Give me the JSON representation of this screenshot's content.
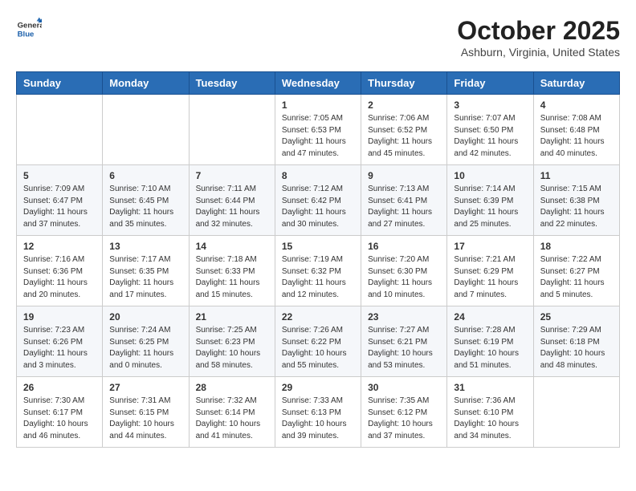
{
  "header": {
    "logo_general": "General",
    "logo_blue": "Blue",
    "month": "October 2025",
    "location": "Ashburn, Virginia, United States"
  },
  "days_of_week": [
    "Sunday",
    "Monday",
    "Tuesday",
    "Wednesday",
    "Thursday",
    "Friday",
    "Saturday"
  ],
  "weeks": [
    [
      {
        "day": "",
        "content": ""
      },
      {
        "day": "",
        "content": ""
      },
      {
        "day": "",
        "content": ""
      },
      {
        "day": "1",
        "content": "Sunrise: 7:05 AM\nSunset: 6:53 PM\nDaylight: 11 hours and 47 minutes."
      },
      {
        "day": "2",
        "content": "Sunrise: 7:06 AM\nSunset: 6:52 PM\nDaylight: 11 hours and 45 minutes."
      },
      {
        "day": "3",
        "content": "Sunrise: 7:07 AM\nSunset: 6:50 PM\nDaylight: 11 hours and 42 minutes."
      },
      {
        "day": "4",
        "content": "Sunrise: 7:08 AM\nSunset: 6:48 PM\nDaylight: 11 hours and 40 minutes."
      }
    ],
    [
      {
        "day": "5",
        "content": "Sunrise: 7:09 AM\nSunset: 6:47 PM\nDaylight: 11 hours and 37 minutes."
      },
      {
        "day": "6",
        "content": "Sunrise: 7:10 AM\nSunset: 6:45 PM\nDaylight: 11 hours and 35 minutes."
      },
      {
        "day": "7",
        "content": "Sunrise: 7:11 AM\nSunset: 6:44 PM\nDaylight: 11 hours and 32 minutes."
      },
      {
        "day": "8",
        "content": "Sunrise: 7:12 AM\nSunset: 6:42 PM\nDaylight: 11 hours and 30 minutes."
      },
      {
        "day": "9",
        "content": "Sunrise: 7:13 AM\nSunset: 6:41 PM\nDaylight: 11 hours and 27 minutes."
      },
      {
        "day": "10",
        "content": "Sunrise: 7:14 AM\nSunset: 6:39 PM\nDaylight: 11 hours and 25 minutes."
      },
      {
        "day": "11",
        "content": "Sunrise: 7:15 AM\nSunset: 6:38 PM\nDaylight: 11 hours and 22 minutes."
      }
    ],
    [
      {
        "day": "12",
        "content": "Sunrise: 7:16 AM\nSunset: 6:36 PM\nDaylight: 11 hours and 20 minutes."
      },
      {
        "day": "13",
        "content": "Sunrise: 7:17 AM\nSunset: 6:35 PM\nDaylight: 11 hours and 17 minutes."
      },
      {
        "day": "14",
        "content": "Sunrise: 7:18 AM\nSunset: 6:33 PM\nDaylight: 11 hours and 15 minutes."
      },
      {
        "day": "15",
        "content": "Sunrise: 7:19 AM\nSunset: 6:32 PM\nDaylight: 11 hours and 12 minutes."
      },
      {
        "day": "16",
        "content": "Sunrise: 7:20 AM\nSunset: 6:30 PM\nDaylight: 11 hours and 10 minutes."
      },
      {
        "day": "17",
        "content": "Sunrise: 7:21 AM\nSunset: 6:29 PM\nDaylight: 11 hours and 7 minutes."
      },
      {
        "day": "18",
        "content": "Sunrise: 7:22 AM\nSunset: 6:27 PM\nDaylight: 11 hours and 5 minutes."
      }
    ],
    [
      {
        "day": "19",
        "content": "Sunrise: 7:23 AM\nSunset: 6:26 PM\nDaylight: 11 hours and 3 minutes."
      },
      {
        "day": "20",
        "content": "Sunrise: 7:24 AM\nSunset: 6:25 PM\nDaylight: 11 hours and 0 minutes."
      },
      {
        "day": "21",
        "content": "Sunrise: 7:25 AM\nSunset: 6:23 PM\nDaylight: 10 hours and 58 minutes."
      },
      {
        "day": "22",
        "content": "Sunrise: 7:26 AM\nSunset: 6:22 PM\nDaylight: 10 hours and 55 minutes."
      },
      {
        "day": "23",
        "content": "Sunrise: 7:27 AM\nSunset: 6:21 PM\nDaylight: 10 hours and 53 minutes."
      },
      {
        "day": "24",
        "content": "Sunrise: 7:28 AM\nSunset: 6:19 PM\nDaylight: 10 hours and 51 minutes."
      },
      {
        "day": "25",
        "content": "Sunrise: 7:29 AM\nSunset: 6:18 PM\nDaylight: 10 hours and 48 minutes."
      }
    ],
    [
      {
        "day": "26",
        "content": "Sunrise: 7:30 AM\nSunset: 6:17 PM\nDaylight: 10 hours and 46 minutes."
      },
      {
        "day": "27",
        "content": "Sunrise: 7:31 AM\nSunset: 6:15 PM\nDaylight: 10 hours and 44 minutes."
      },
      {
        "day": "28",
        "content": "Sunrise: 7:32 AM\nSunset: 6:14 PM\nDaylight: 10 hours and 41 minutes."
      },
      {
        "day": "29",
        "content": "Sunrise: 7:33 AM\nSunset: 6:13 PM\nDaylight: 10 hours and 39 minutes."
      },
      {
        "day": "30",
        "content": "Sunrise: 7:35 AM\nSunset: 6:12 PM\nDaylight: 10 hours and 37 minutes."
      },
      {
        "day": "31",
        "content": "Sunrise: 7:36 AM\nSunset: 6:10 PM\nDaylight: 10 hours and 34 minutes."
      },
      {
        "day": "",
        "content": ""
      }
    ]
  ]
}
